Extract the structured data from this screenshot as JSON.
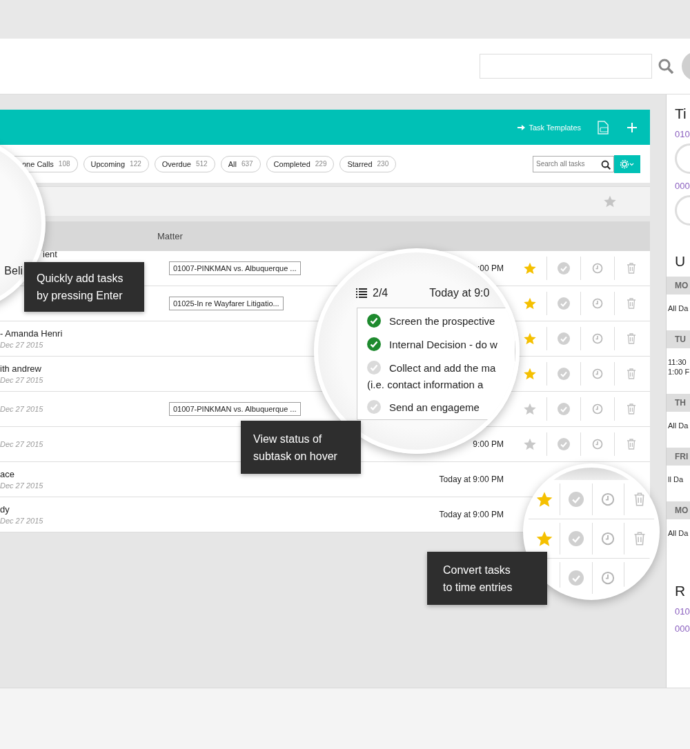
{
  "toolbar": {
    "link": "Task Templates"
  },
  "filters": [
    {
      "label": "one Calls",
      "count": "108",
      "selected": false
    },
    {
      "label": "Upcoming",
      "count": "122",
      "selected": false
    },
    {
      "label": "Overdue",
      "count": "512",
      "selected": false
    },
    {
      "label": "All",
      "count": "637",
      "selected": false
    },
    {
      "label": "Completed",
      "count": "229",
      "selected": false
    },
    {
      "label": "Starred",
      "count": "230",
      "selected": false
    }
  ],
  "task_search": {
    "placeholder": "Search all tasks"
  },
  "table": {
    "columns": [
      "Matter"
    ],
    "rows": [
      {
        "title": "ient",
        "matter": "01007-PINKMAN vs. Albuquerque ...",
        "due": ":00 PM",
        "starred": true
      },
      {
        "matter": "01025-In re Wayfarer Litigatio...",
        "starred": true
      },
      {
        "title": "- Amanda Henri",
        "date": "Dec 27 2015",
        "starred": true
      },
      {
        "title": "ith andrew",
        "date": "Dec 27 2015",
        "starred": true
      },
      {
        "date": "Dec 27 2015",
        "matter": "01007-PINKMAN vs. Albuquerque ...",
        "starred": false
      },
      {
        "date": "Dec 27 2015",
        "due": "9:00 PM",
        "starred": false
      },
      {
        "title": "ace",
        "date": "Dec 27 2015",
        "due": "Today at 9:00 PM"
      },
      {
        "title": "dy",
        "date": "Dec 27 2015",
        "due": "Today at 9:00 PM"
      }
    ]
  },
  "lens_left": {
    "text": "Beli"
  },
  "lens_subtasks": {
    "count": "2/4",
    "due": "Today at 9:0",
    "subtasks": [
      {
        "lines": [
          "Screen the prospective"
        ],
        "done": true
      },
      {
        "lines": [
          "Internal Decision - do w"
        ],
        "done": true
      },
      {
        "lines": [
          "Collect and add the ma",
          "(i.e. contact information a"
        ],
        "done": false
      },
      {
        "lines": [
          "Send an engageme"
        ],
        "done": false
      }
    ]
  },
  "lens_actions": [
    {
      "starred": true
    },
    {
      "starred": true
    }
  ],
  "tooltips": [
    {
      "lines": [
        "Quickly add tasks",
        "by pressing Enter"
      ]
    },
    {
      "lines": [
        "View status of",
        "subtask on hover"
      ]
    },
    {
      "lines": [
        "Convert tasks",
        "to time entries"
      ]
    }
  ],
  "sidebar": {
    "timer_title": "Ti",
    "timers": [
      "010",
      "000"
    ],
    "upcoming_title": "U",
    "days": [
      {
        "day": "MO",
        "entries": [
          "All Da"
        ]
      },
      {
        "day": "TU",
        "entries": [
          "11:30",
          "1:00 F"
        ]
      },
      {
        "day": "TH",
        "entries": [
          "All Da"
        ]
      },
      {
        "day": "FRI",
        "entries": [
          "ll Da"
        ]
      },
      {
        "day": "MO",
        "entries": [
          "All Da"
        ]
      }
    ],
    "recent_title": "R",
    "recent": [
      "010",
      "000"
    ]
  }
}
